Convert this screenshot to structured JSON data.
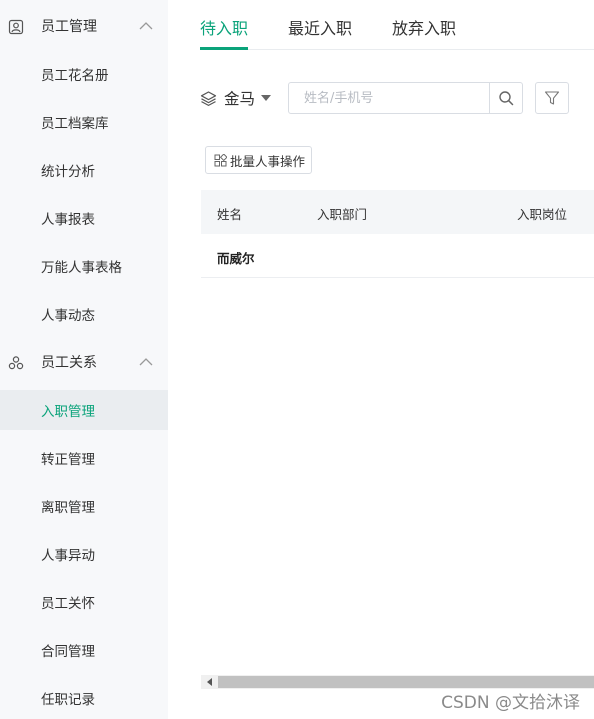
{
  "sidebar": {
    "groups": [
      {
        "label": "员工管理",
        "icon": "person-icon",
        "items": [
          {
            "label": "员工花名册"
          },
          {
            "label": "员工档案库"
          },
          {
            "label": "统计分析"
          },
          {
            "label": "人事报表"
          },
          {
            "label": "万能人事表格"
          },
          {
            "label": "人事动态"
          }
        ]
      },
      {
        "label": "员工关系",
        "icon": "relations-icon",
        "items": [
          {
            "label": "入职管理",
            "active": true
          },
          {
            "label": "转正管理"
          },
          {
            "label": "离职管理"
          },
          {
            "label": "人事异动"
          },
          {
            "label": "员工关怀"
          },
          {
            "label": "合同管理"
          },
          {
            "label": "任职记录"
          }
        ]
      }
    ]
  },
  "tabs": [
    {
      "label": "待入职",
      "active": true
    },
    {
      "label": "最近入职"
    },
    {
      "label": "放弃入职"
    }
  ],
  "toolbar": {
    "company": "金马",
    "search_placeholder": "姓名/手机号",
    "search_value": ""
  },
  "batch_button": "批量人事操作",
  "table": {
    "columns": [
      "姓名",
      "入职部门",
      "入职岗位"
    ],
    "rows": [
      [
        "而威尔",
        "",
        ""
      ]
    ]
  },
  "watermark": "CSDN @文拾沐译",
  "colors": {
    "accent": "#0aa37a",
    "sidebar_bg": "#f7f8fa",
    "active_item_bg": "#eaedf0"
  }
}
